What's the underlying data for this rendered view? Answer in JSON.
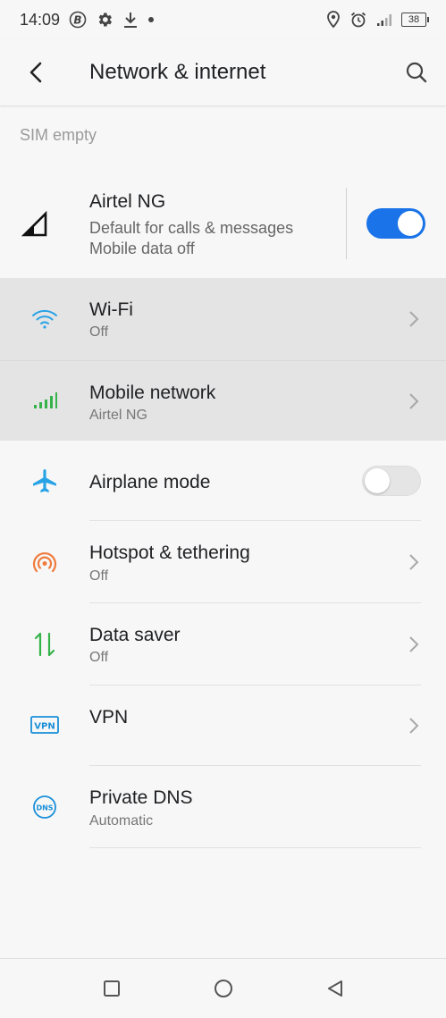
{
  "status_bar": {
    "time": "14:09",
    "battery": "38",
    "icons": [
      "b-circle-icon",
      "gear-icon",
      "download-icon",
      "dot-icon",
      "location-icon",
      "alarm-icon",
      "signal-icon",
      "battery-icon"
    ]
  },
  "header": {
    "title": "Network & internet",
    "back_icon": "back-arrow-icon",
    "search_icon": "search-icon"
  },
  "section_header": "SIM empty",
  "sim": {
    "name": "Airtel NG",
    "line1": "Default for calls & messages",
    "line2": "Mobile data off",
    "toggle_on": true,
    "accent": "#1a73e8"
  },
  "items": [
    {
      "id": "wifi",
      "title": "Wi-Fi",
      "subtitle": "Off",
      "icon": "wifi-icon",
      "icon_color": "#29a3e6",
      "chevron": true,
      "highlighted": true
    },
    {
      "id": "mobile",
      "title": "Mobile network",
      "subtitle": "Airtel NG",
      "icon": "signal-bars-icon",
      "icon_color": "#34b349",
      "chevron": true,
      "highlighted": true
    },
    {
      "id": "airplane",
      "title": "Airplane mode",
      "subtitle": "",
      "icon": "airplane-icon",
      "icon_color": "#29a3e6",
      "toggle_on": false
    },
    {
      "id": "hotspot",
      "title": "Hotspot & tethering",
      "subtitle": "Off",
      "icon": "hotspot-icon",
      "icon_color": "#ef7b3c",
      "chevron": true
    },
    {
      "id": "datasaver",
      "title": "Data saver",
      "subtitle": "Off",
      "icon": "data-saver-icon",
      "icon_color": "#34b349",
      "chevron": true
    },
    {
      "id": "vpn",
      "title": "VPN",
      "subtitle": "",
      "icon": "vpn-icon",
      "icon_color": "#1a8fd8",
      "icon_text": "VPN",
      "chevron": true
    },
    {
      "id": "dns",
      "title": "Private DNS",
      "subtitle": "Automatic",
      "icon": "dns-icon",
      "icon_color": "#1a8fd8",
      "icon_text": "DNS"
    }
  ],
  "nav": {
    "recents_icon": "square-recents-icon",
    "home_icon": "circle-home-icon",
    "back_icon": "triangle-back-icon"
  }
}
